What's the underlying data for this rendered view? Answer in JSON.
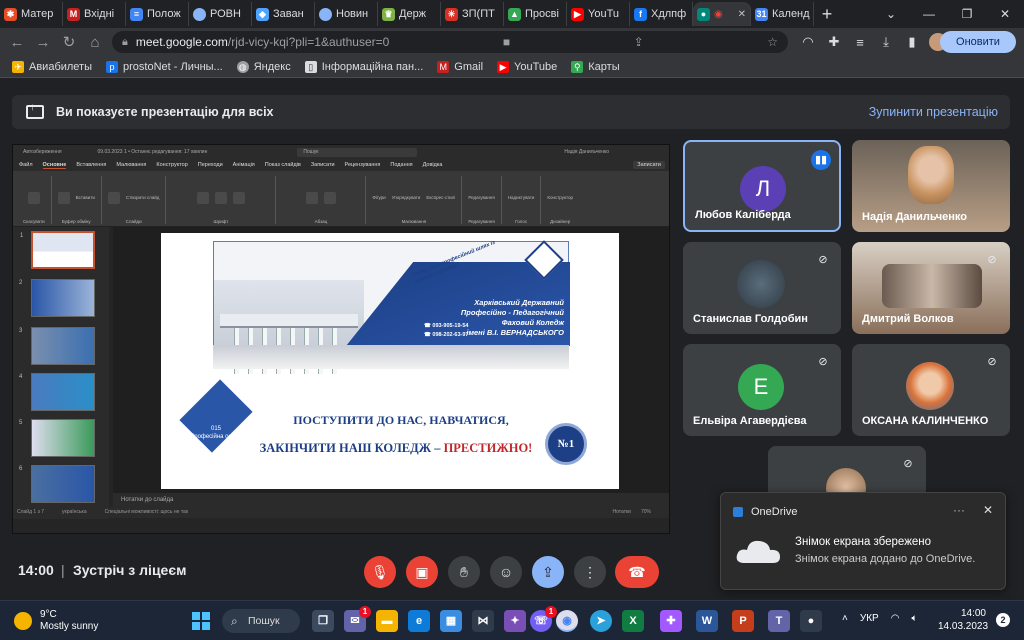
{
  "browser": {
    "tabs": [
      {
        "label": "Матер",
        "icon": "joomla-icon",
        "color": "#e44d26"
      },
      {
        "label": "Вхідні",
        "icon": "gmail-icon",
        "color": "#c5221f"
      },
      {
        "label": "Полож",
        "icon": "docs-icon",
        "color": "#4285f4"
      },
      {
        "label": "РОВН",
        "icon": "link-icon",
        "color": "#8ab4f8"
      },
      {
        "label": "Заван",
        "icon": "diamond-icon",
        "color": "#4fa3ff"
      },
      {
        "label": "Новин",
        "icon": "link-icon",
        "color": "#8ab4f8"
      },
      {
        "label": "Держ",
        "icon": "emblem-icon",
        "color": "#7cb342"
      },
      {
        "label": "ЗП(ПТ",
        "icon": "asterisk-icon",
        "color": "#d93025"
      },
      {
        "label": "Просві",
        "icon": "drive-icon",
        "color": "#34a853"
      },
      {
        "label": "YouTu",
        "icon": "youtube-icon",
        "color": "#ff0000"
      },
      {
        "label": "Хдлпф",
        "icon": "facebook-icon",
        "color": "#1877f2"
      },
      {
        "label": "",
        "icon": "meet-icon",
        "color": "#00897b",
        "active": true
      },
      {
        "label": "Календ",
        "icon": "calendar-icon",
        "color": "#4285f4"
      }
    ],
    "url_host": "meet.google.com",
    "url_path": "/rjd-vicy-kqi?pli=1&authuser=0",
    "update_button": "Оновити",
    "bookmarks": [
      {
        "label": "Авиабилеты",
        "icon": "plane-icon",
        "color": "#f4b400"
      },
      {
        "label": "prostoNet - Личны...",
        "icon": "prostonet-icon",
        "color": "#1a73e8"
      },
      {
        "label": "Яндекс",
        "icon": "globe-icon",
        "color": "#9aa0a6"
      },
      {
        "label": "Інформаційна пан...",
        "icon": "bookmark-icon",
        "color": "#dadce0"
      },
      {
        "label": "Gmail",
        "icon": "gmail-icon",
        "color": "#c5221f"
      },
      {
        "label": "YouTube",
        "icon": "youtube-icon",
        "color": "#ff0000"
      },
      {
        "label": "Карты",
        "icon": "maps-icon",
        "color": "#34a853"
      }
    ]
  },
  "banner": {
    "text": "Ви показуєте презентацію для всіх",
    "stop": "Зупинити презентацію"
  },
  "ppt": {
    "title": "09.03.2023 1 • Останнє редагування: 17 хвилин",
    "search": "Пошук",
    "user": "Надія Данильченко",
    "autosave": "Автозбереження",
    "menu": [
      "Файл",
      "Основне",
      "Вставлення",
      "Малювання",
      "Конструктор",
      "Переходи",
      "Анімація",
      "Показ слайдів",
      "Записати",
      "Рецензування",
      "Подання",
      "Довідка"
    ],
    "notes_btn": "Записати",
    "groups": [
      "Скасувати",
      "Буфер обміну",
      "Слайди",
      "Шрифт",
      "Абзац",
      "Малювання",
      "Редагування",
      "Голос",
      "Дизайнер"
    ],
    "buttons": [
      "Вставити",
      "Створити слайд",
      "Фігури",
      "Упорядкувати",
      "Експрес-стилі",
      "Редагування",
      "Надиктувати",
      "Конструктор"
    ],
    "notes_placeholder": "Нотатки до слайда",
    "status": [
      "Слайд 1 з 7",
      "українська",
      "Спеціальні можливості: щось не так",
      "Нотатки",
      "70%"
    ],
    "thumb_numbers": [
      "1",
      "2",
      "3",
      "4",
      "5",
      "6"
    ]
  },
  "slide": {
    "tagline": "Почни свій професійний шлях із нашого коледжу!",
    "college_lines": [
      "Харківський Державний",
      "Професійно - Педагогічний",
      "Фаховий Коледж",
      "імені В.І. ВЕРНАДСЬКОГО"
    ],
    "phones": [
      "☎ 093-905-19-54",
      "☎ 098-202-63-97"
    ],
    "diamond_text": [
      "015",
      "Професійна освіта"
    ],
    "line1": "ПОСТУПИТИ ДО НАС, НАВЧАТИСЯ,",
    "line2a": "ЗАКІНЧИТИ НАШ КОЛЕДЖ – ",
    "line2b": "ПРЕСТИЖНО!",
    "badge": "№1"
  },
  "participants": [
    {
      "name": "Любов Каліберда",
      "type": "letter",
      "letter": "Л",
      "color": "#5b3fb5",
      "mic": "on",
      "active": true
    },
    {
      "name": "Надія Данильченко",
      "type": "video",
      "mic": "none"
    },
    {
      "name": "Станислав Голдобин",
      "type": "photo",
      "mic": "off"
    },
    {
      "name": "Дмитрий Волков",
      "type": "video",
      "mic": "off"
    },
    {
      "name": "Ельвіра Агавердієва",
      "type": "letter",
      "letter": "Е",
      "color": "#34a853",
      "mic": "off"
    },
    {
      "name": "ОКСАНА КАЛИНЧЕНКО",
      "type": "photo",
      "mic": "off"
    }
  ],
  "meeting": {
    "time": "14:00",
    "separator": "|",
    "name": "Зустріч з ліцеєм"
  },
  "toast": {
    "app": "OneDrive",
    "title": "Знімок екрана збережено",
    "body": "Знімок екрана додано до OneDrive."
  },
  "taskbar": {
    "temp": "9°C",
    "weather": "Mostly sunny",
    "search": "Пошук",
    "lang": "УКР",
    "time": "14:00",
    "date": "14.03.2023",
    "notifications": "2",
    "badges": {
      "chat": "1",
      "viber": "1"
    }
  },
  "colors": {
    "accent": "#8ab4f8",
    "hangup": "#ea4335",
    "slide_blue": "#1d3f86",
    "slide_red": "#c0282d"
  }
}
